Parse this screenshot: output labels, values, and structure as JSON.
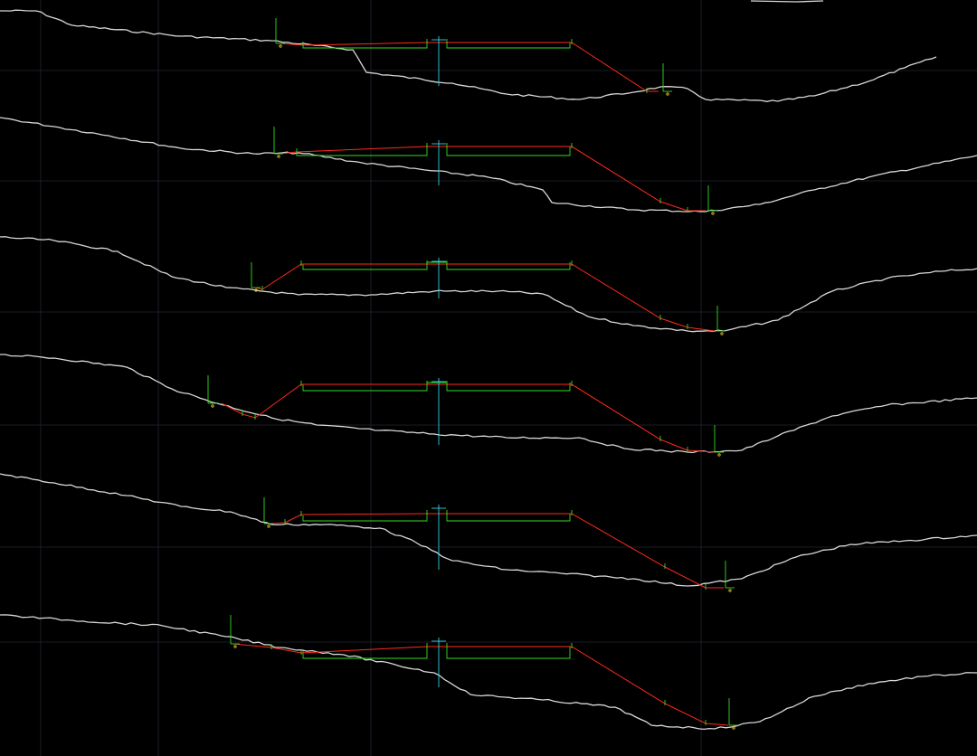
{
  "drawing": {
    "background": "#000000",
    "colors": {
      "ground_line": "#d8d8d8",
      "design_line": "#ff2a1a",
      "subgrade_line": "#33dd22",
      "centerline": "#2fd0e0",
      "labels": "#8bff6a"
    }
  }
}
